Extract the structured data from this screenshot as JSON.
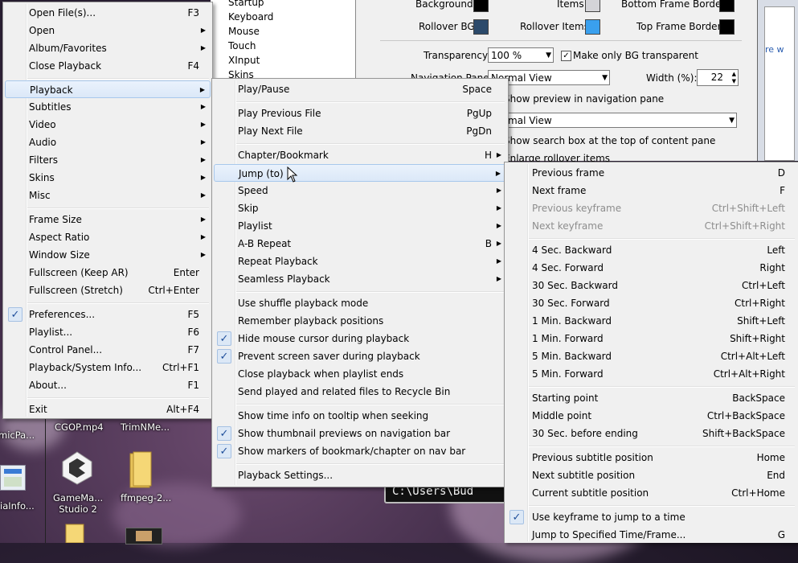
{
  "desktop": {
    "icons": [
      {
        "label": "CGOP.mp4"
      },
      {
        "label": "TrimNMe..."
      },
      {
        "label": "micPa..."
      },
      {
        "label": "iaInfo..."
      },
      {
        "label": "GameMa... Studio 2"
      },
      {
        "label": "ffmpeg-2..."
      }
    ],
    "path_text": "C:\\Users\\Bud"
  },
  "tree_window": {
    "items": [
      "Startup",
      "Keyboard",
      "Mouse",
      "Touch",
      "XInput",
      "Skins"
    ]
  },
  "settings_window": {
    "background_label": "Background:",
    "items_label": "Items:",
    "bottom_frame_border_label": "Bottom Frame Border:",
    "rollover_bg_label": "Rollover BG:",
    "rollover_items_label": "Rollover Items:",
    "top_frame_border_label": "Top Frame Border:",
    "transparency_label": "Transparency:",
    "transparency_value": "100 %",
    "make_bg_transparent_label": "Make only BG transparent",
    "navigation_pane_label": "Navigation Pane:",
    "navigation_pane_value": "Normal View",
    "width_label": "Width (%):",
    "width_value": "22",
    "show_preview_label": "Show preview in navigation pane",
    "content_view_value": "Normal View",
    "show_search_label": "Show search box at the top of content pane",
    "enlarge_label": "Enlarge rollover items",
    "right_link": "re w"
  },
  "colors": {
    "swatch_black": "#000000",
    "swatch_items": "#d4d4d8",
    "swatch_rollover_bg": "#2c4a6b",
    "swatch_rollover_items": "#3aa0ee",
    "check_color": "#1f4f9b"
  },
  "main_menu": {
    "items": [
      {
        "label": "Open File(s)...",
        "shortcut": "F3"
      },
      {
        "label": "Open",
        "submenu": true
      },
      {
        "label": "Album/Favorites",
        "submenu": true
      },
      {
        "label": "Close Playback",
        "shortcut": "F4"
      },
      {
        "label": "Playback",
        "submenu": true,
        "highlighted": true
      },
      {
        "label": "Subtitles",
        "submenu": true
      },
      {
        "label": "Video",
        "submenu": true
      },
      {
        "label": "Audio",
        "submenu": true
      },
      {
        "label": "Filters",
        "submenu": true
      },
      {
        "label": "Skins",
        "submenu": true
      },
      {
        "label": "Misc",
        "submenu": true
      },
      {
        "label": "Frame Size",
        "submenu": true
      },
      {
        "label": "Aspect Ratio",
        "submenu": true
      },
      {
        "label": "Window Size",
        "submenu": true
      },
      {
        "label": "Fullscreen (Keep AR)",
        "shortcut": "Enter"
      },
      {
        "label": "Fullscreen (Stretch)",
        "shortcut": "Ctrl+Enter"
      },
      {
        "label": "Preferences...",
        "shortcut": "F5",
        "checked": true
      },
      {
        "label": "Playlist...",
        "shortcut": "F6"
      },
      {
        "label": "Control Panel...",
        "shortcut": "F7"
      },
      {
        "label": "Playback/System Info...",
        "shortcut": "Ctrl+F1"
      },
      {
        "label": "About...",
        "shortcut": "F1"
      },
      {
        "label": "Exit",
        "shortcut": "Alt+F4"
      }
    ]
  },
  "playback_menu": {
    "items": [
      {
        "label": "Play/Pause",
        "shortcut": "Space"
      },
      {
        "label": "Play Previous File",
        "shortcut": "PgUp"
      },
      {
        "label": "Play Next File",
        "shortcut": "PgDn"
      },
      {
        "label": "Chapter/Bookmark",
        "shortcut": "H",
        "submenu": true
      },
      {
        "label": "Jump (to)",
        "submenu": true,
        "highlighted": true
      },
      {
        "label": "Speed",
        "submenu": true
      },
      {
        "label": "Skip",
        "submenu": true
      },
      {
        "label": "Playlist",
        "submenu": true
      },
      {
        "label": "A-B Repeat",
        "shortcut": "B",
        "submenu": true
      },
      {
        "label": "Repeat Playback",
        "submenu": true
      },
      {
        "label": "Seamless Playback",
        "submenu": true
      },
      {
        "label": "Use shuffle playback mode"
      },
      {
        "label": "Remember playback positions"
      },
      {
        "label": "Hide mouse cursor during playback",
        "checked": true
      },
      {
        "label": "Prevent screen saver during playback",
        "checked": true
      },
      {
        "label": "Close playback when playlist ends"
      },
      {
        "label": "Send played and related files to Recycle Bin"
      },
      {
        "label": "Show time info on tooltip when seeking"
      },
      {
        "label": "Show thumbnail previews on navigation bar",
        "checked": true
      },
      {
        "label": "Show markers of bookmark/chapter on nav bar",
        "checked": true
      },
      {
        "label": "Playback Settings..."
      }
    ]
  },
  "jump_menu": {
    "items": [
      {
        "label": "Previous frame",
        "shortcut": "D"
      },
      {
        "label": "Next frame",
        "shortcut": "F"
      },
      {
        "label": "Previous keyframe",
        "shortcut": "Ctrl+Shift+Left",
        "disabled": true
      },
      {
        "label": "Next keyframe",
        "shortcut": "Ctrl+Shift+Right",
        "disabled": true
      },
      {
        "label": "4 Sec. Backward",
        "shortcut": "Left"
      },
      {
        "label": "4 Sec. Forward",
        "shortcut": "Right"
      },
      {
        "label": "30 Sec. Backward",
        "shortcut": "Ctrl+Left"
      },
      {
        "label": "30 Sec. Forward",
        "shortcut": "Ctrl+Right"
      },
      {
        "label": "1 Min. Backward",
        "shortcut": "Shift+Left"
      },
      {
        "label": "1 Min. Forward",
        "shortcut": "Shift+Right"
      },
      {
        "label": "5 Min. Backward",
        "shortcut": "Ctrl+Alt+Left"
      },
      {
        "label": "5 Min. Forward",
        "shortcut": "Ctrl+Alt+Right"
      },
      {
        "label": "Starting point",
        "shortcut": "BackSpace"
      },
      {
        "label": "Middle point",
        "shortcut": "Ctrl+BackSpace"
      },
      {
        "label": "30 Sec. before ending",
        "shortcut": "Shift+BackSpace"
      },
      {
        "label": "Previous subtitle position",
        "shortcut": "Home"
      },
      {
        "label": "Next subtitle position",
        "shortcut": "End"
      },
      {
        "label": "Current subtitle position",
        "shortcut": "Ctrl+Home"
      },
      {
        "label": "Use keyframe to jump to a time",
        "checked": true
      },
      {
        "label": "Jump to Specified Time/Frame...",
        "shortcut": "G"
      }
    ]
  }
}
